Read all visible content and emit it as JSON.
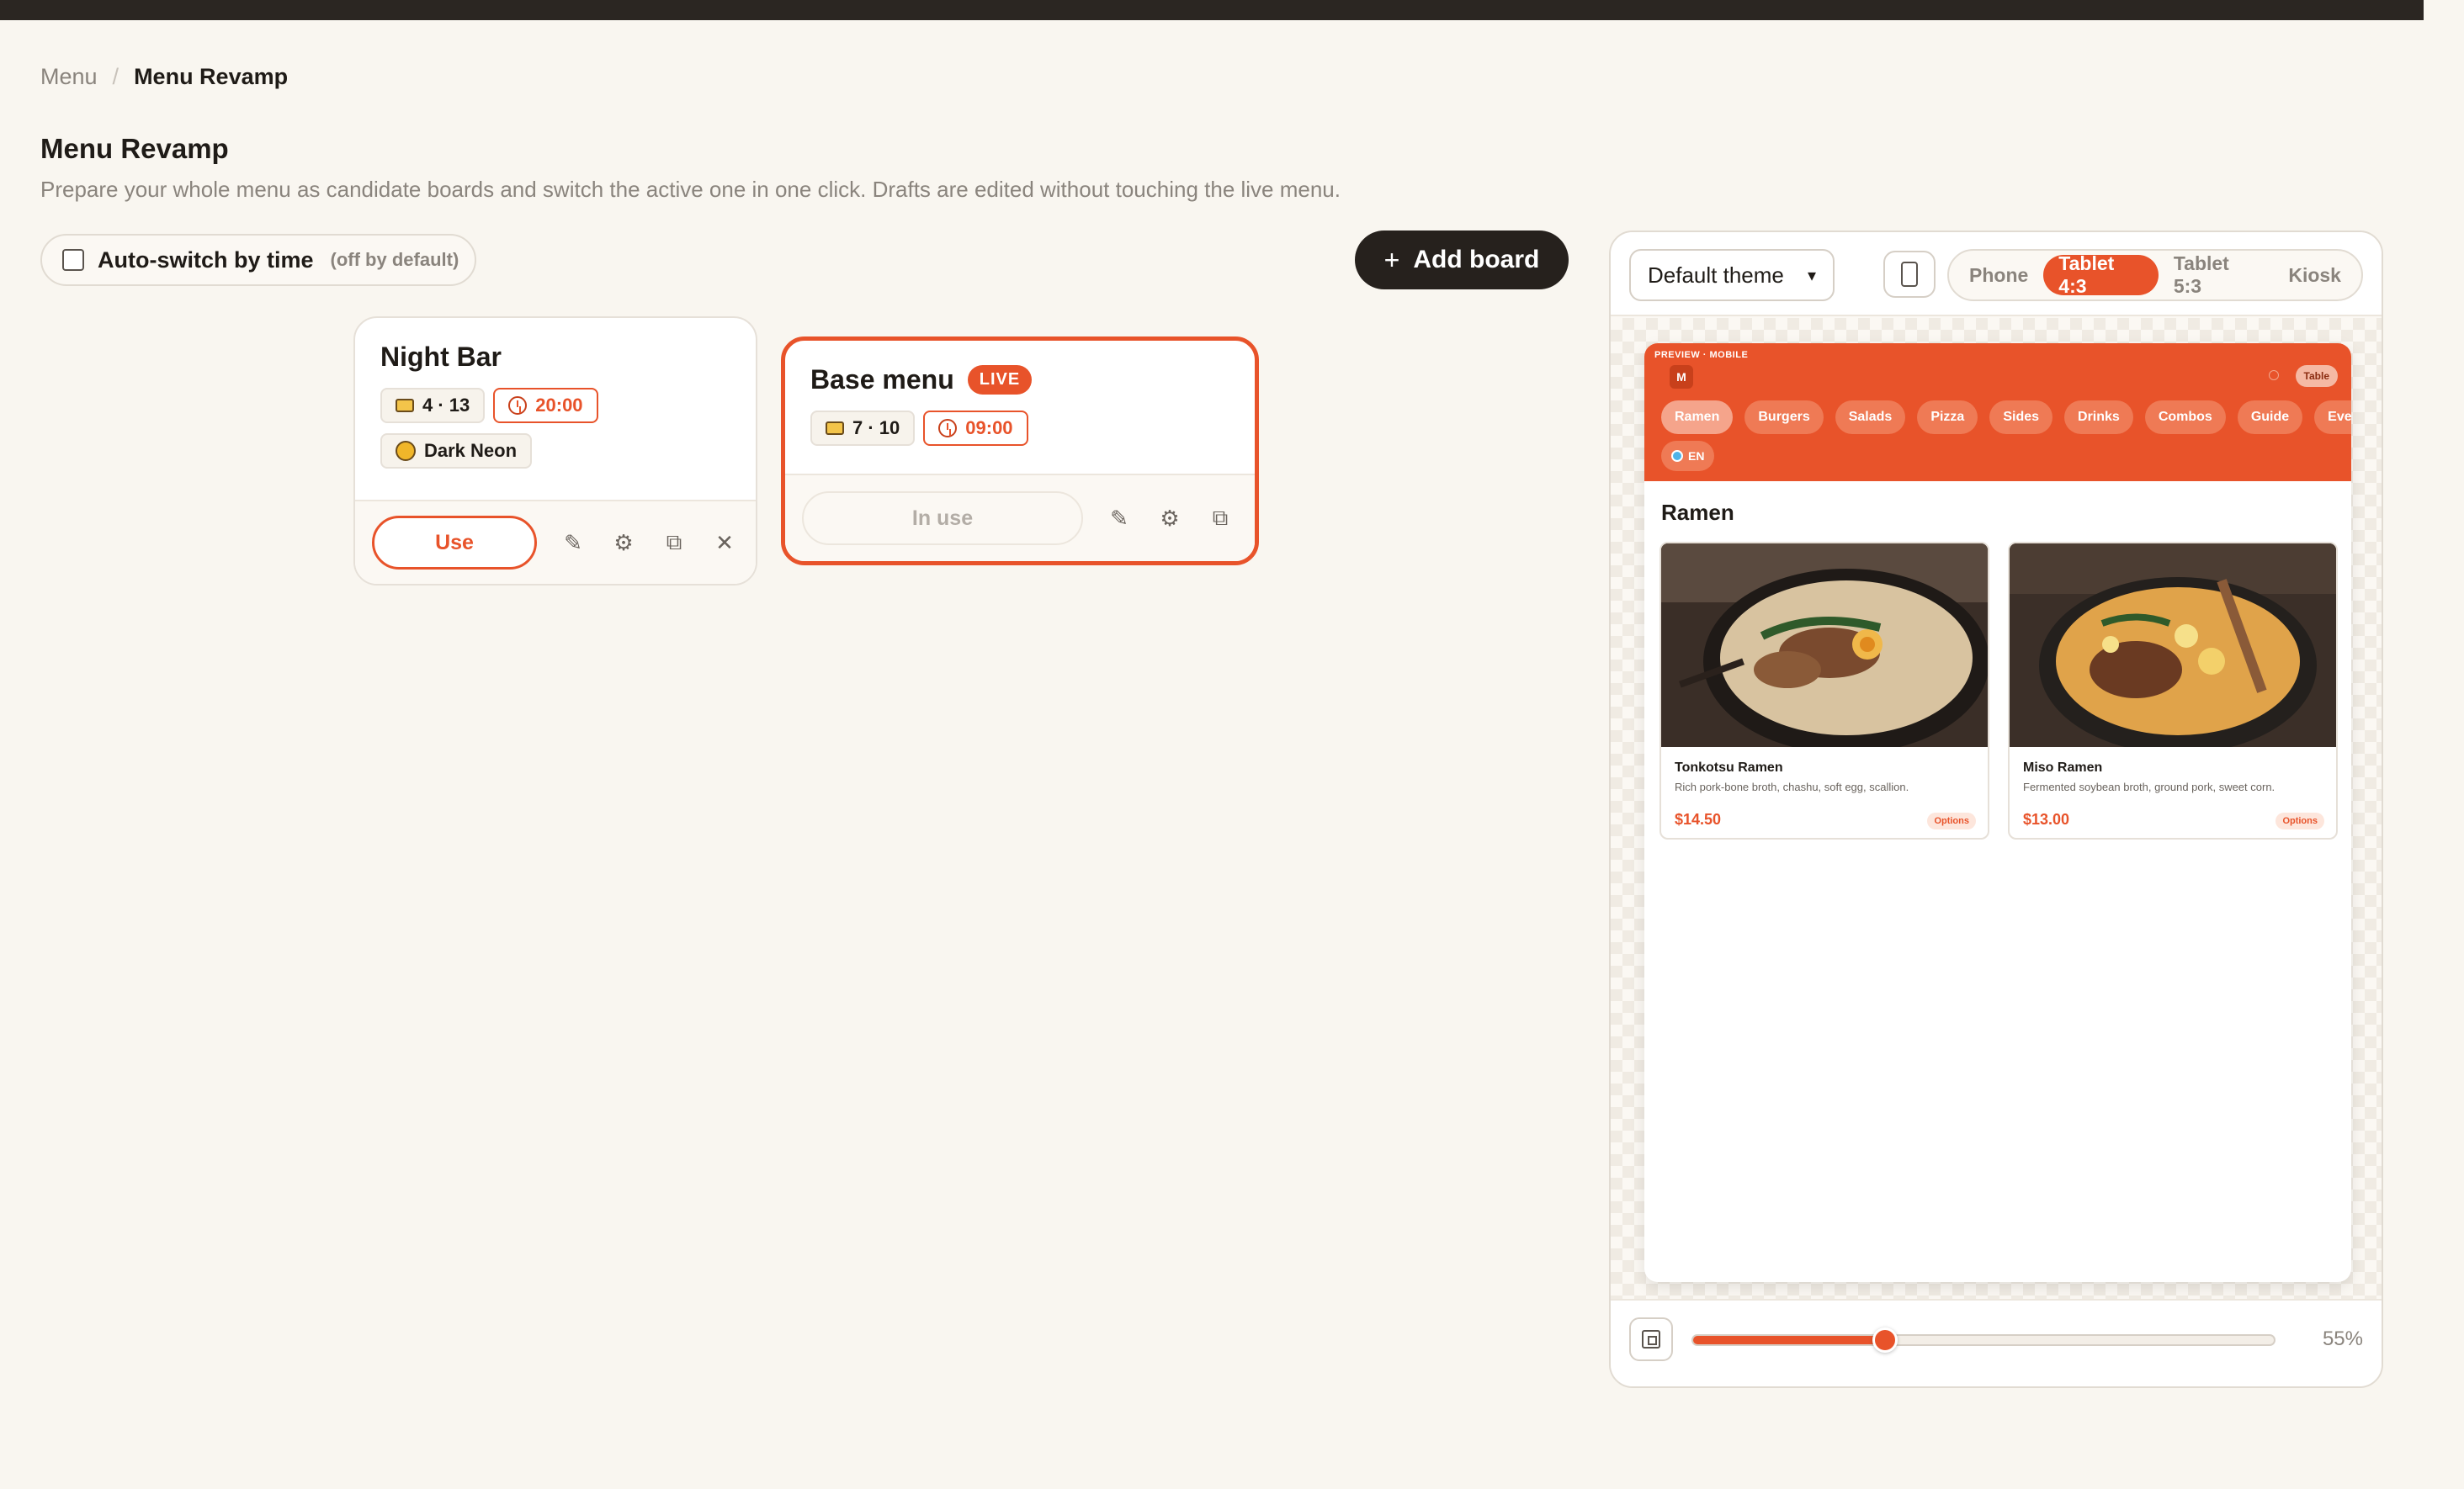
{
  "breadcrumb": {
    "parent": "Menu",
    "separator": "/",
    "current": "Menu Revamp"
  },
  "page": {
    "title": "Menu Revamp",
    "subtitle": "Prepare your whole menu as candidate boards and switch the active one in one click. Drafts are edited without touching the live menu."
  },
  "auto_switch": {
    "label": "Auto-switch by time",
    "hint": "(off by default)",
    "checked": false
  },
  "add_board": {
    "icon": "plus-icon",
    "label": "Add board"
  },
  "boards": [
    {
      "name": "Night Bar",
      "range": "4 · 13",
      "time": "20:00",
      "theme": "Dark Neon",
      "action": "Use",
      "live": false
    },
    {
      "name": "Base menu",
      "badge": "LIVE",
      "range": "7 · 10",
      "time": "09:00",
      "action": "In use",
      "live": true
    }
  ],
  "preview": {
    "theme_select": "Default theme",
    "devices": [
      "Phone",
      "Tablet 4:3",
      "Tablet 5:3",
      "Kiosk"
    ],
    "active_device": "Tablet 4:3",
    "zoom": "55%",
    "zoom_value": 0.33,
    "screen": {
      "eyebrow": "PREVIEW · MOBILE",
      "logo": "M",
      "table_badge": "Table",
      "tabs": [
        "Ramen",
        "Burgers",
        "Salads",
        "Pizza",
        "Sides",
        "Drinks",
        "Combos",
        "Guide",
        "Events"
      ],
      "active_tab": "Ramen",
      "language": "EN",
      "section": "Ramen",
      "dishes": [
        {
          "name": "Tonkotsu Ramen",
          "desc": "Rich pork-bone broth, chashu, soft egg, scallion.",
          "price": "$14.50",
          "tag": "Options"
        },
        {
          "name": "Miso Ramen",
          "desc": "Fermented soybean broth, ground pork, sweet corn.",
          "price": "$13.00",
          "tag": "Options"
        }
      ]
    }
  },
  "colors": {
    "accent": "#e8532a",
    "dark": "#26211d",
    "background": "#f9f6f0"
  }
}
